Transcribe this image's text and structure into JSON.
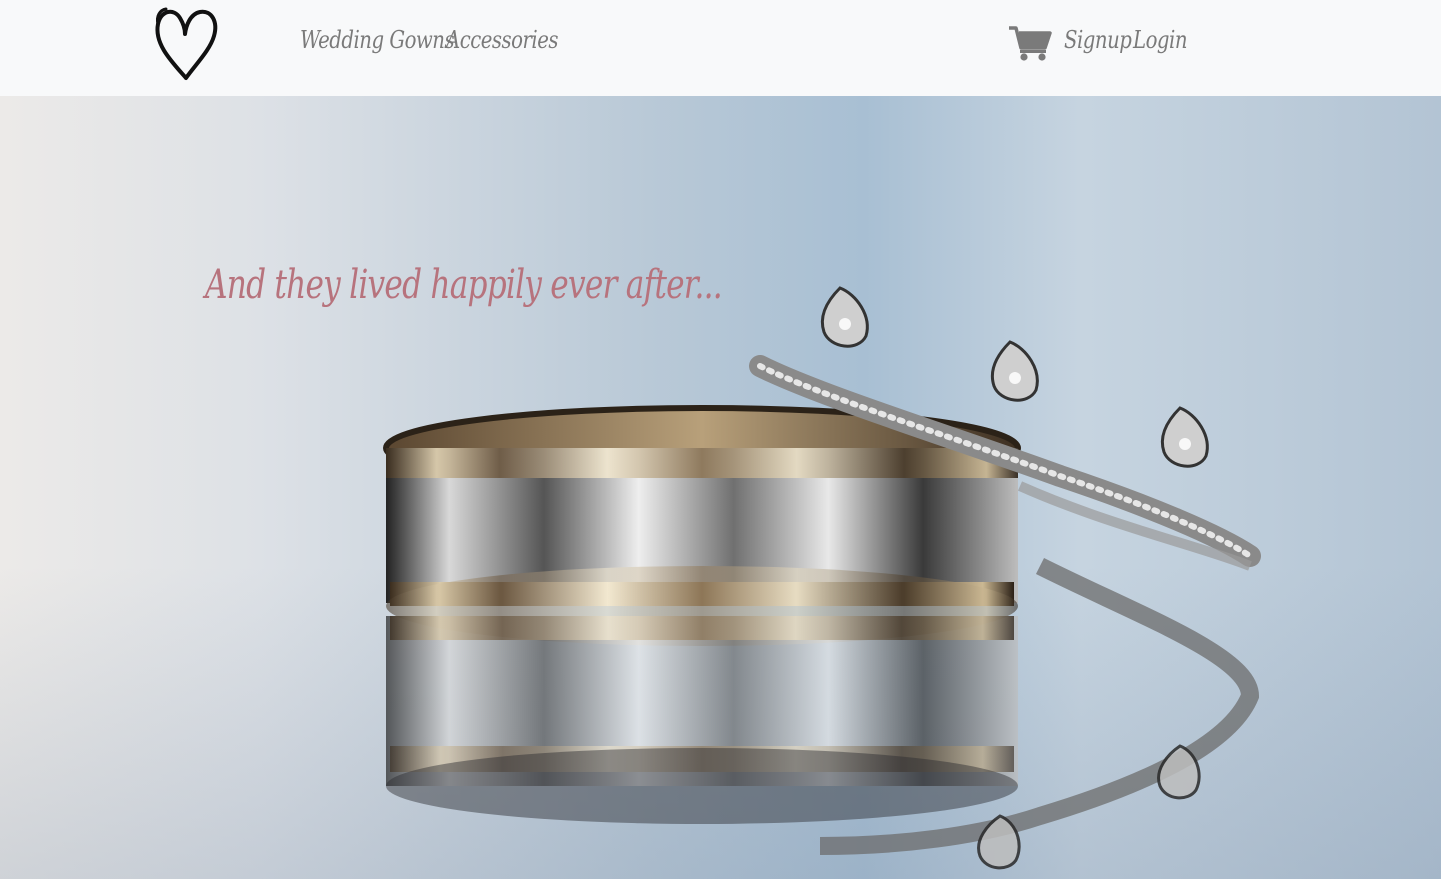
{
  "navbar": {
    "logo_icon": "heart-icon",
    "links": [
      {
        "label": "Wedding Gowns"
      },
      {
        "label": "Accessories"
      }
    ],
    "cart_icon": "shopping-cart-icon",
    "auth": {
      "signup_label": "Signup",
      "login_label": "Login"
    }
  },
  "hero": {
    "tagline": "And they lived happily ever after...",
    "image": "wedding-rings-photo"
  },
  "colors": {
    "navbar_bg": "#f8f9fa",
    "nav_text": "#7a7a7a",
    "tagline": "#b7737d"
  }
}
